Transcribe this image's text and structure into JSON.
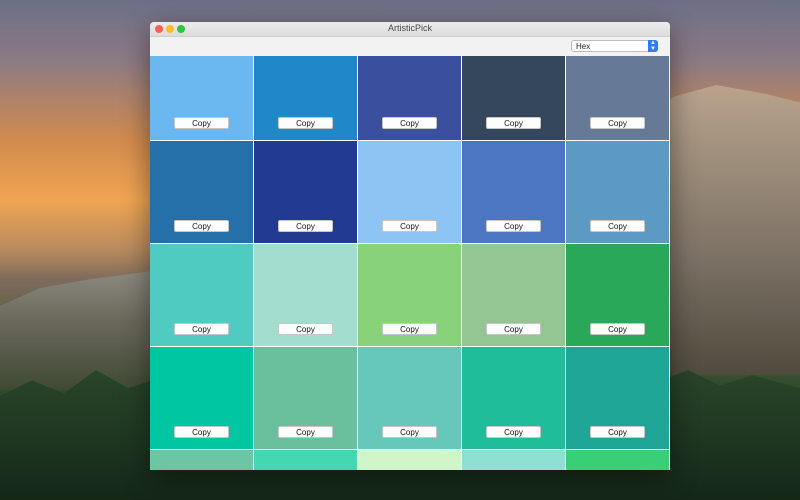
{
  "window": {
    "title": "ArtisticPick"
  },
  "toolbar": {
    "format_selected": "Hex"
  },
  "copy_label": "Copy",
  "swatches": [
    "#6bb7ef",
    "#2188c8",
    "#3a4f9d",
    "#35475c",
    "#667a97",
    "#2570a8",
    "#233a93",
    "#8cc4f3",
    "#4c76c2",
    "#5c9ac4",
    "#4fcbc2",
    "#a2ddd0",
    "#88d279",
    "#93c693",
    "#2aa85a",
    "#00c6a2",
    "#6abf9d",
    "#66c7bb",
    "#1fbe9b",
    "#1fa595",
    "#6cc5a3",
    "#45d7b2",
    "#cff5c8",
    "#8ee0d2",
    "#38cf77"
  ]
}
